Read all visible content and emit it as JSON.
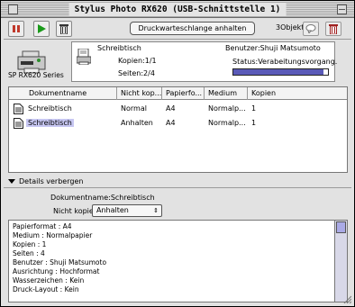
{
  "window": {
    "title": "Stylus Photo RX620 (USB-Schnittstelle 1)"
  },
  "toolbar": {
    "pause_icon": "pause-icon",
    "play_icon": "play-icon",
    "trash_icon": "trash-icon",
    "stop_queue_label": "Druckwarteschlange anhalten",
    "object_count": "3Objekte"
  },
  "printer": {
    "model_label": "SP RX620 Series"
  },
  "current_job": {
    "name": "Schreibtisch",
    "copies": "Kopien:1/1",
    "pages": "Seiten:2/4",
    "user": "Benutzer:Shuji Matsumoto",
    "status": "Status:Verabeitungsvorgang.",
    "progress": 0.95
  },
  "queue": {
    "columns": [
      "Dokumentname",
      "Nicht kop...",
      "Papierfo...",
      "Medium",
      "Kopien"
    ],
    "rows": [
      {
        "name": "Schreibtisch",
        "nocopy": "Normal",
        "paper": "A4",
        "medium": "Normalp...",
        "copies": "1"
      },
      {
        "name": "Schreibtisch",
        "nocopy": "Anhalten",
        "paper": "A4",
        "medium": "Normalp...",
        "copies": "1"
      }
    ]
  },
  "details": {
    "toggle_label": "Details verbergen",
    "docname_line": "Dokumentname:Schreibtisch",
    "nocopy_label": "Nicht kopieren :",
    "nocopy_value": "Anhalten",
    "lines": [
      "Papierformat : A4",
      "Medium : Normalpapier",
      "Kopien : 1",
      "Seiten : 4",
      "Benutzer : Shuji Matsumoto",
      " Ausrichtung : Hochformat",
      " Wasserzeichen : Kein",
      "Druck-Layout : Kein"
    ]
  },
  "colors": {
    "selection": "#c7c7f2",
    "progress": "#5a5ab8",
    "play": "#1a9a1a",
    "pause": "#c0392b"
  }
}
